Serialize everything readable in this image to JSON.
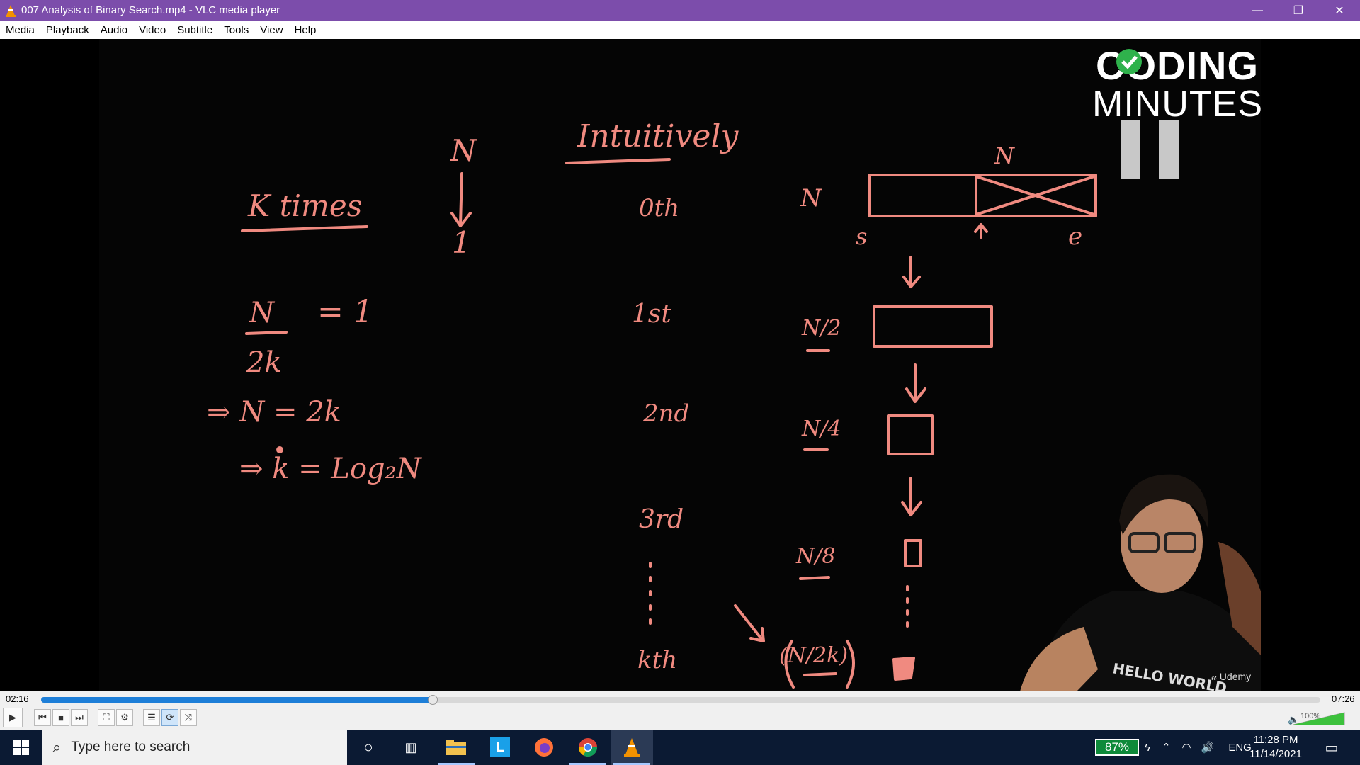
{
  "window": {
    "title": "007 Analysis of Binary Search.mp4 - VLC media player",
    "minimize_label": "—",
    "maximize_label": "❐",
    "close_label": "✕"
  },
  "menu": [
    "Media",
    "Playback",
    "Audio",
    "Video",
    "Subtitle",
    "Tools",
    "View",
    "Help"
  ],
  "video": {
    "logo_line1": "CODING",
    "logo_line2": "MINUTES",
    "watermark": "Udemy",
    "shirt_text": "HELLO WORLD",
    "board": {
      "heading": "Intuitively",
      "left_label": "K  times",
      "top_n": "N",
      "top_one": "1",
      "eq1_num": "N",
      "eq1_den": "2k",
      "eq1_rhs": "= 1",
      "eq2": "⇒  N  =  2k",
      "eq3": "⇒ k = Log₂N",
      "steps": [
        "0th",
        "1st",
        "2nd",
        "3rd",
        "kth"
      ],
      "sizes": [
        "N",
        "N/2",
        "N/4",
        "N/8",
        "(N/2k)"
      ],
      "array_label_n": "N",
      "array_s": "s",
      "array_e": "e"
    },
    "ink_color": "#f08a80"
  },
  "player": {
    "elapsed": "02:16",
    "total": "07:26",
    "progress": 0.306,
    "volume_label": "100%",
    "volume": 1.0,
    "buttons": {
      "play": "▶",
      "prev": "⏮",
      "stop": "■",
      "next": "⏭",
      "fullscreen": "⛶",
      "extended": "⚙",
      "playlist": "☰",
      "loop": "⟳",
      "shuffle": "⤨"
    }
  },
  "taskbar": {
    "search_placeholder": "Type here to search",
    "battery": "87%",
    "language": "ENG",
    "time": "11:28 PM",
    "date": "11/14/2021"
  }
}
